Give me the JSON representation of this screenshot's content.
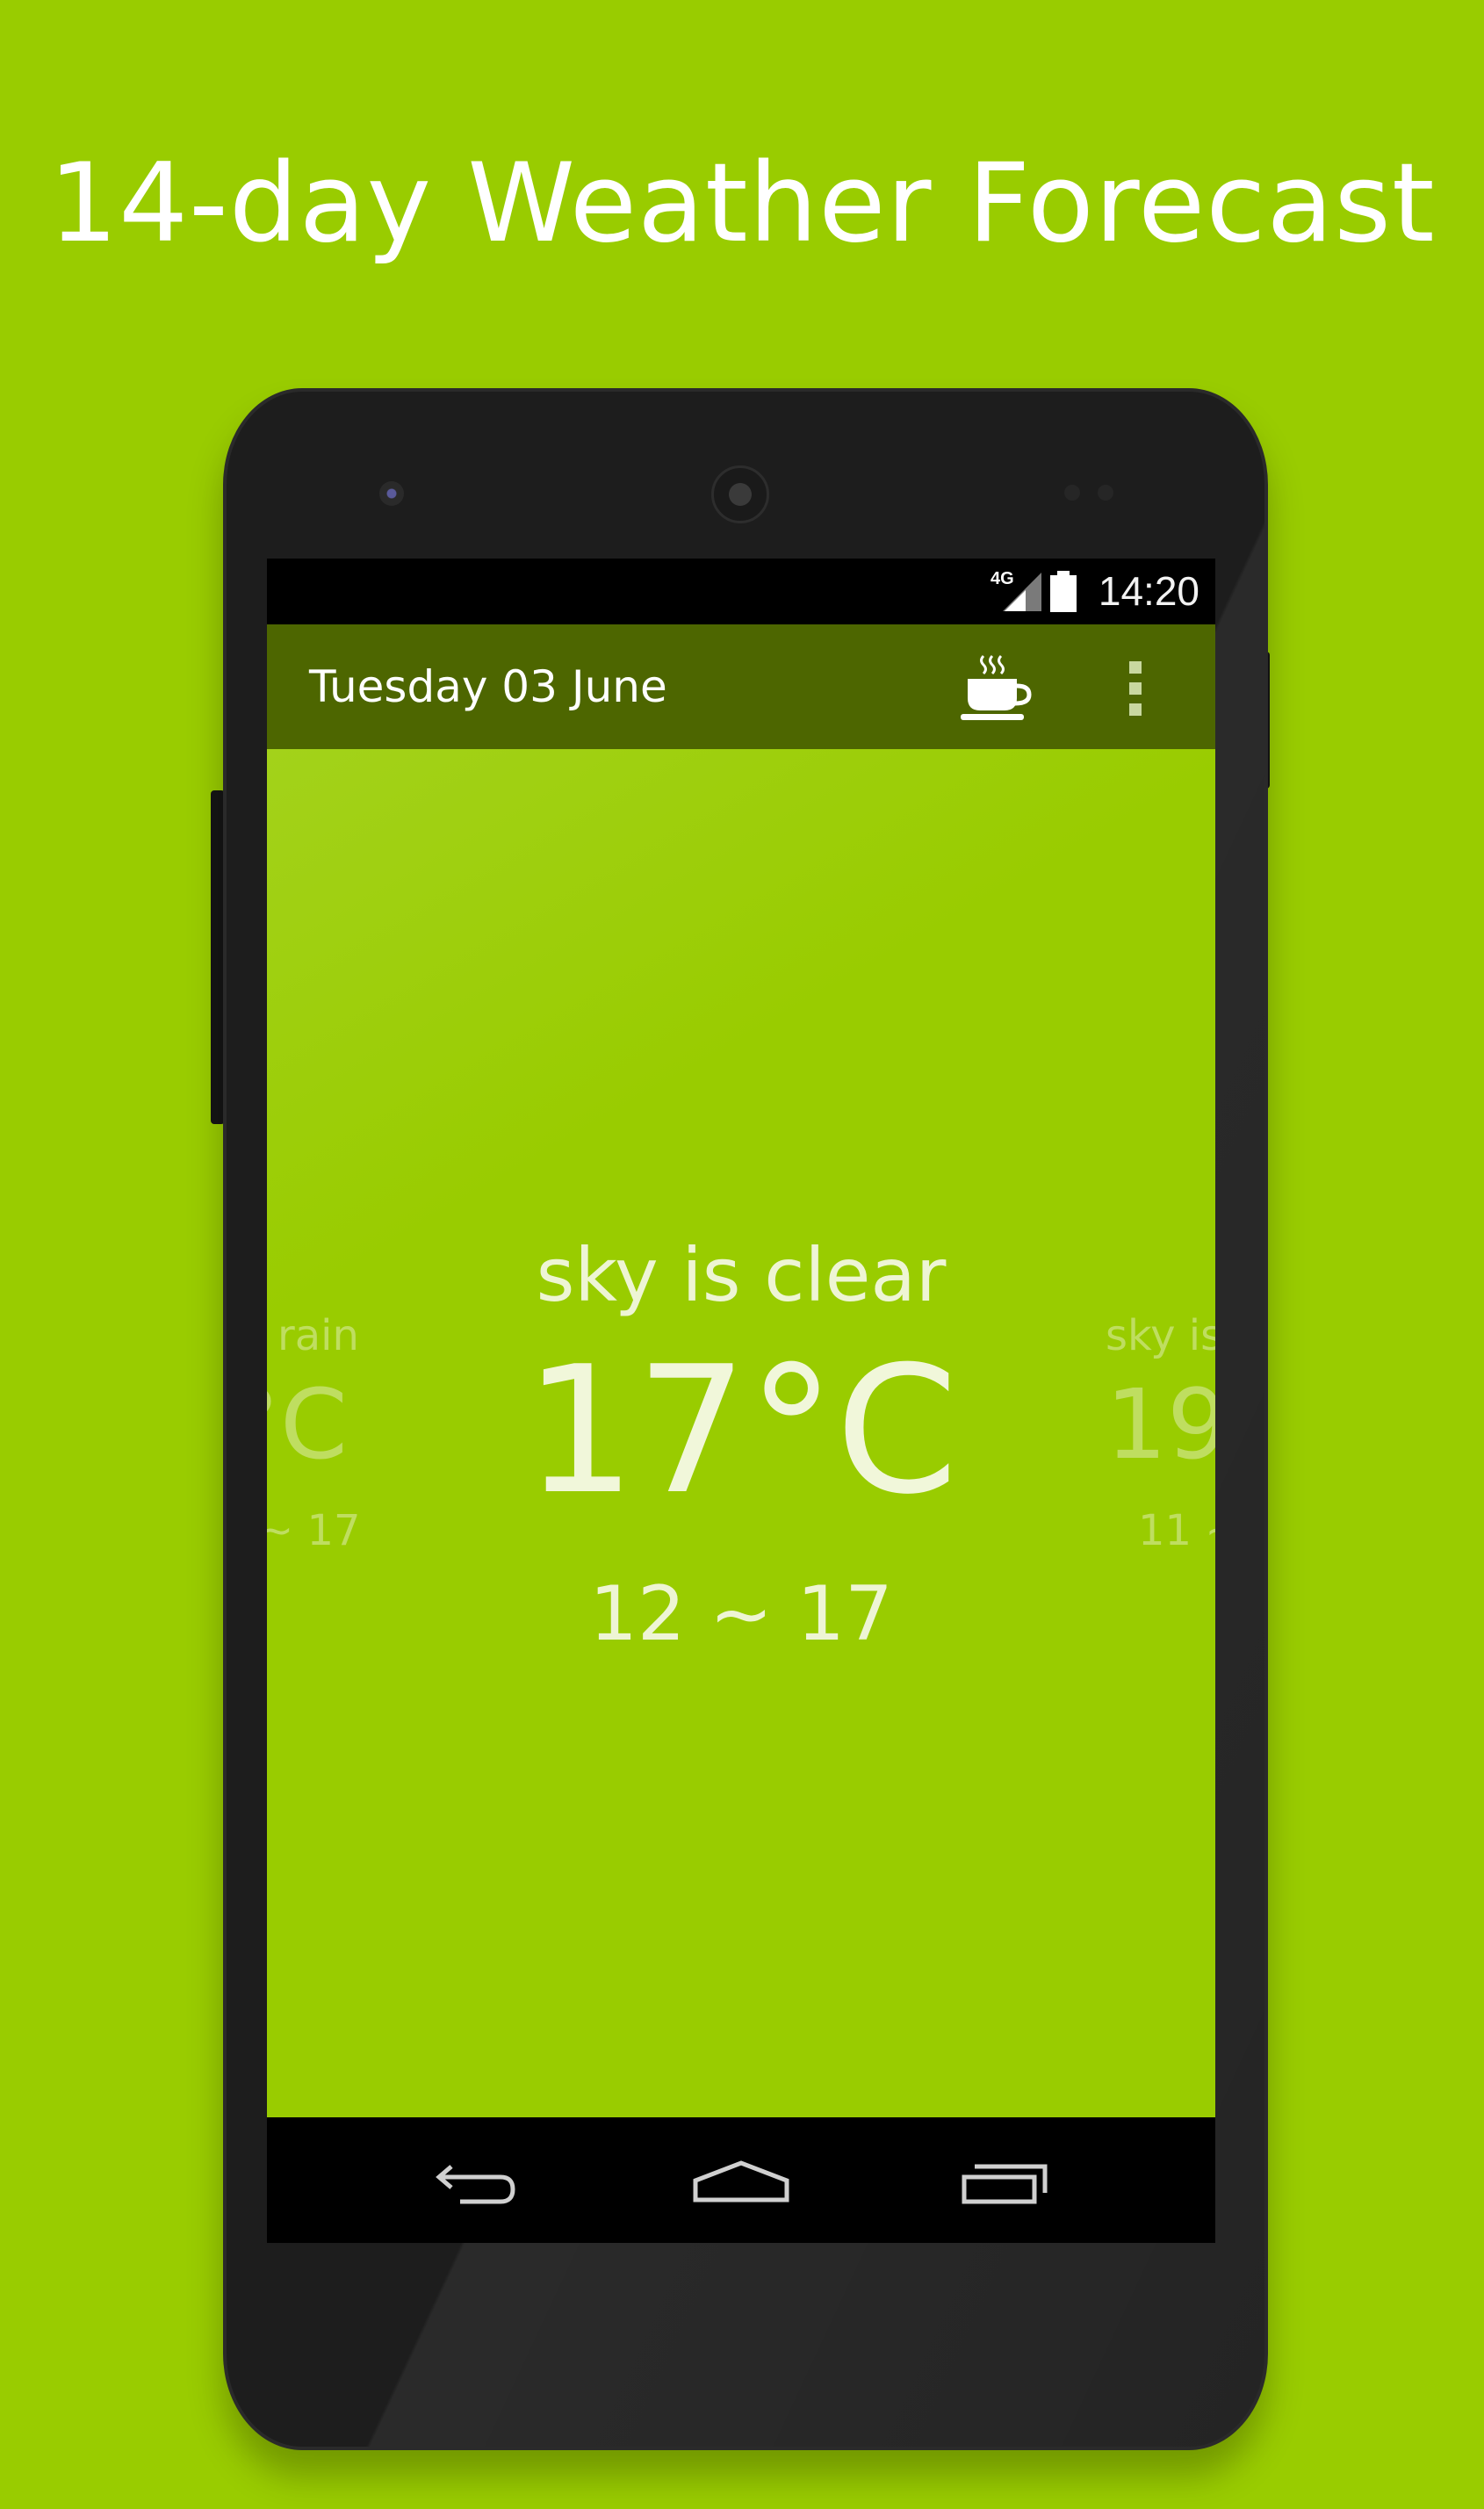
{
  "headline": "14-day Weather Forecast",
  "status_bar": {
    "network": "4G",
    "time": "14:20"
  },
  "app_bar": {
    "date": "Tuesday 03 June",
    "actions": [
      "coffee-cup-icon",
      "overflow-menu-icon"
    ]
  },
  "forecast": {
    "current": {
      "description": "sky is clear",
      "temperature": "17°C",
      "range": "12 ~ 17"
    },
    "previous": {
      "description": "rain",
      "temperature": "°C",
      "range": "~ 17"
    },
    "next": {
      "description": "sky is",
      "temperature": "19",
      "range": "11 ~"
    }
  },
  "nav_bar": [
    "back-icon",
    "home-icon",
    "recents-icon"
  ],
  "colors": {
    "background": "#99cc00",
    "app_bar": "#4d6600",
    "text": "#ffffff"
  }
}
